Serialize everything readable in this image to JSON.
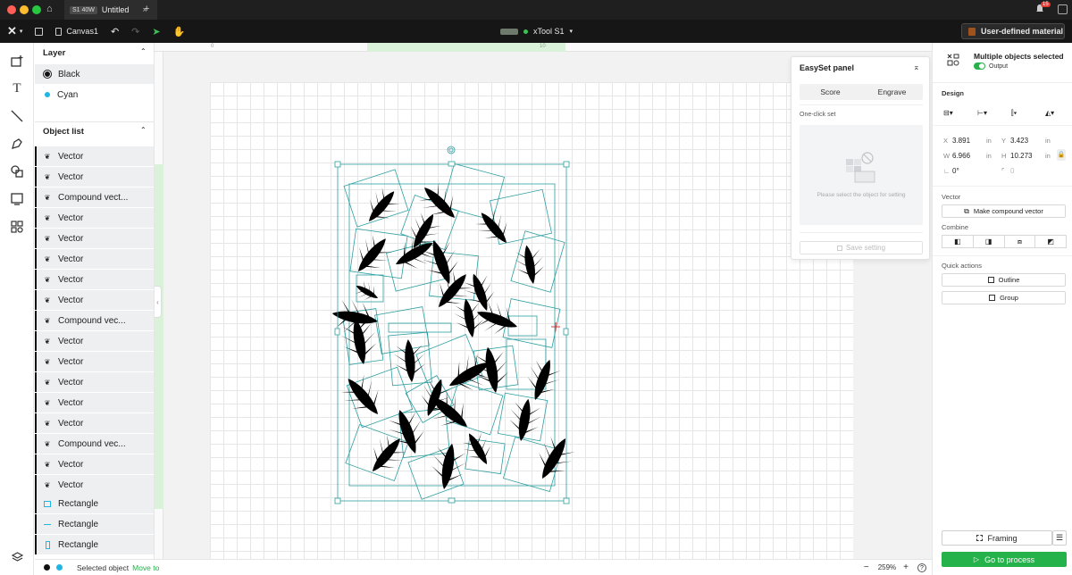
{
  "titlebar": {
    "tab_badge": "S1 40W",
    "tab_title": "Untitled",
    "close_glyph": "×",
    "add_glyph": "+",
    "notification_count": "15"
  },
  "toolbar": {
    "logo": "✕",
    "canvas_label": "Canvas1",
    "device_name": "xTool S1",
    "material_label": "User-defined material"
  },
  "layers": {
    "title": "Layer",
    "items": [
      {
        "label": "Black",
        "color": "#111111"
      },
      {
        "label": "Cyan",
        "color": "#1fb6e3"
      }
    ]
  },
  "object_list": {
    "title": "Object list",
    "items": [
      {
        "label": "Vector",
        "icon": "leaf-icon"
      },
      {
        "label": "Vector",
        "icon": "leaf-icon"
      },
      {
        "label": "Compound vect...",
        "icon": "leaf-icon"
      },
      {
        "label": "Vector",
        "icon": "leaf-icon"
      },
      {
        "label": "Vector",
        "icon": "leaf-icon"
      },
      {
        "label": "Vector",
        "icon": "leaf-icon"
      },
      {
        "label": "Vector",
        "icon": "leaf-icon"
      },
      {
        "label": "Vector",
        "icon": "leaf-icon"
      },
      {
        "label": "Compound vec...",
        "icon": "leaf-icon"
      },
      {
        "label": "Vector",
        "icon": "leaf-icon"
      },
      {
        "label": "Vector",
        "icon": "leaf-icon"
      },
      {
        "label": "Vector",
        "icon": "leaf-icon"
      },
      {
        "label": "Vector",
        "icon": "leaf-icon"
      },
      {
        "label": "Vector",
        "icon": "leaf-icon"
      },
      {
        "label": "Compound vec...",
        "icon": "leaf-icon"
      },
      {
        "label": "Vector",
        "icon": "leaf-icon"
      },
      {
        "label": "Vector",
        "icon": "leaf-icon"
      },
      {
        "label": "Rectangle",
        "icon": "rectangle-icon"
      },
      {
        "label": "Rectangle",
        "icon": "line-icon"
      },
      {
        "label": "Rectangle",
        "icon": "tall-rectangle-icon"
      }
    ]
  },
  "easyset": {
    "title": "EasySet panel",
    "tabs": [
      "Score",
      "Engrave"
    ],
    "section_label": "One-click set",
    "empty_hint": "Please select the object for setting",
    "save_label": "Save setting"
  },
  "properties": {
    "title": "Multiple objects selected",
    "output_label": "Output",
    "design_label": "Design",
    "x": "3.891",
    "y": "3.423",
    "w": "6.966",
    "h": "10.273",
    "unit": "in",
    "rotation": "0°",
    "corner": "0",
    "vector_label": "Vector",
    "make_compound_label": "Make compound vector",
    "combine_label": "Combine",
    "quick_actions_label": "Quick actions",
    "outline_label": "Outline",
    "group_label": "Group",
    "framing_label": "Framing",
    "go_label": "Go to process"
  },
  "statusbar": {
    "selected_label": "Selected object",
    "move_to_label": "Move to",
    "zoom": "259%",
    "zoom_minus": "−",
    "zoom_plus": "+"
  },
  "ruler": {
    "marks": [
      "0",
      "10"
    ]
  },
  "colors": {
    "accent_green": "#25b24a",
    "selection_cyan": "#2e9ea0",
    "dark_toolbar": "#161616"
  }
}
